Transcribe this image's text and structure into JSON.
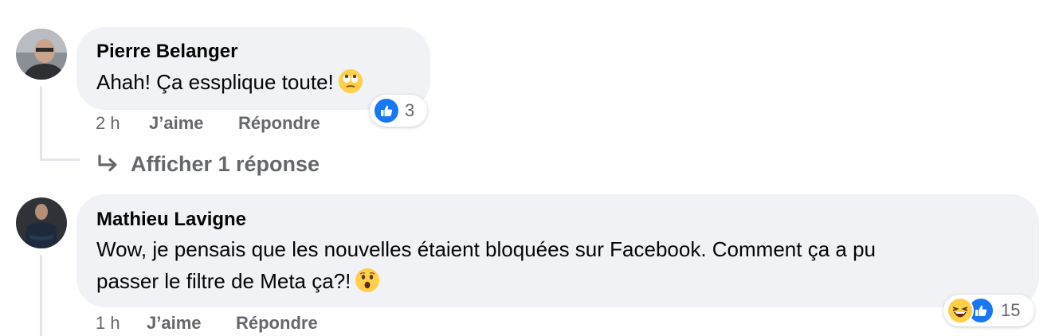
{
  "comments": [
    {
      "author": "Pierre Belanger",
      "text": "Ahah! Ça essplique toute!",
      "emoji": "face-with-rolling-eyes",
      "time": "2 h",
      "like_label": "J’aime",
      "reply_label": "Répondre",
      "reactions": [
        "like"
      ],
      "reaction_count": "3",
      "view_replies": "Afficher 1 réponse"
    },
    {
      "author": "Mathieu Lavigne",
      "text_line1": "Wow, je pensais que les nouvelles étaient bloquées sur Facebook. Comment ça a pu",
      "text_line2": "passer le filtre de Meta ça?!",
      "emoji": "hushed-face",
      "time": "1 h",
      "like_label": "J’aime",
      "reply_label": "Répondre",
      "reactions": [
        "haha",
        "like"
      ],
      "reaction_count": "15"
    }
  ],
  "colors": {
    "bubble": "#f0f2f5",
    "secondary_text": "#65676b",
    "like_blue": "#1877f2",
    "emoji_yellow": "#ffcf47"
  }
}
